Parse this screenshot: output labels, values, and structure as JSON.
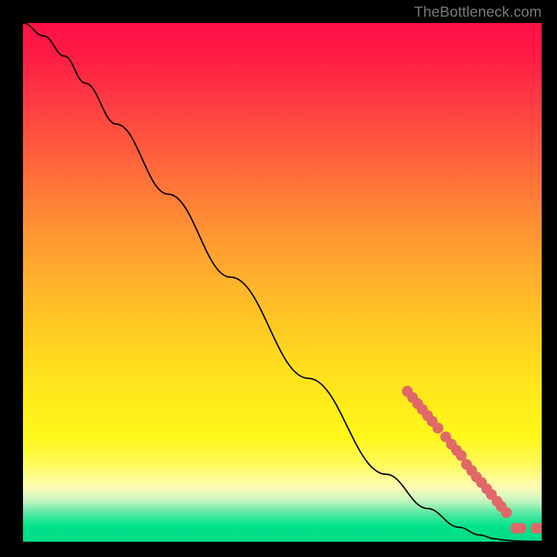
{
  "attribution": "TheBottleneck.com",
  "colors": {
    "curve": "#000000",
    "marker_fill": "#e06868",
    "marker_stroke": "#7d2f2f"
  },
  "chart_data": {
    "type": "line",
    "title": "",
    "xlabel": "",
    "ylabel": "",
    "xlim": [
      0,
      100
    ],
    "ylim": [
      0,
      100
    ],
    "grid": false,
    "legend": false,
    "series": [
      {
        "name": "curve",
        "x": [
          0,
          4,
          8,
          12,
          18,
          28,
          40,
          55,
          70,
          78,
          84,
          88,
          91,
          93,
          95,
          97,
          100
        ],
        "y": [
          100,
          97.5,
          93.6,
          88.4,
          80.5,
          67.0,
          51.0,
          31.5,
          13.0,
          6.4,
          2.8,
          1.3,
          0.55,
          0.28,
          0.15,
          0.08,
          0.04
        ]
      }
    ],
    "markers": {
      "name": "highlighted-points",
      "x": [
        74.1,
        75.1,
        76.1,
        77.0,
        78.0,
        78.9,
        80.0,
        81.5,
        82.6,
        83.6,
        84.5,
        85.5,
        86.5,
        87.4,
        88.4,
        89.4,
        90.3,
        91.4,
        92.2,
        93.2,
        95.0,
        96.0,
        98.9,
        99.8
      ],
      "y": [
        29.0,
        27.8,
        26.6,
        25.5,
        24.3,
        23.2,
        21.9,
        20.2,
        18.8,
        17.6,
        16.6,
        14.9,
        13.7,
        12.5,
        11.4,
        10.2,
        9.1,
        7.8,
        6.8,
        5.6,
        2.6,
        2.6,
        2.6,
        2.6
      ]
    }
  }
}
